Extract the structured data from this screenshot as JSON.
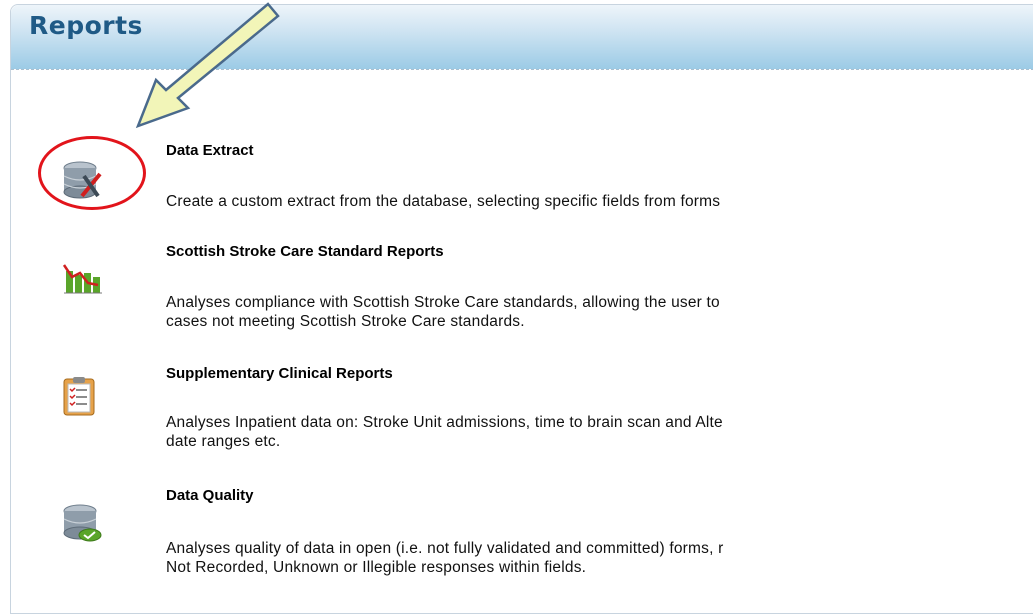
{
  "header": {
    "title": "Reports"
  },
  "items": [
    {
      "title": "Data Extract",
      "description": "Create a custom extract from the database, selecting specific fields from forms",
      "icon": "database-tools-icon"
    },
    {
      "title": "Scottish Stroke Care Standard Reports",
      "description": "Analyses compliance with Scottish Stroke Care standards, allowing the user to\ncases not meeting Scottish Stroke Care standards.",
      "icon": "bar-line-chart-icon"
    },
    {
      "title": "Supplementary Clinical Reports",
      "description": "Analyses Inpatient data on: Stroke Unit admissions, time to brain scan and Alte\ndate ranges etc.",
      "icon": "clipboard-checklist-icon"
    },
    {
      "title": "Data Quality",
      "description": "Analyses quality of data in open (i.e. not fully validated and committed) forms, r\nNot Recorded, Unknown or Illegible responses within fields.",
      "icon": "database-check-icon"
    }
  ],
  "annotation": {
    "arrow_color": "#f2f5b8",
    "circle_color": "#e2141b"
  }
}
